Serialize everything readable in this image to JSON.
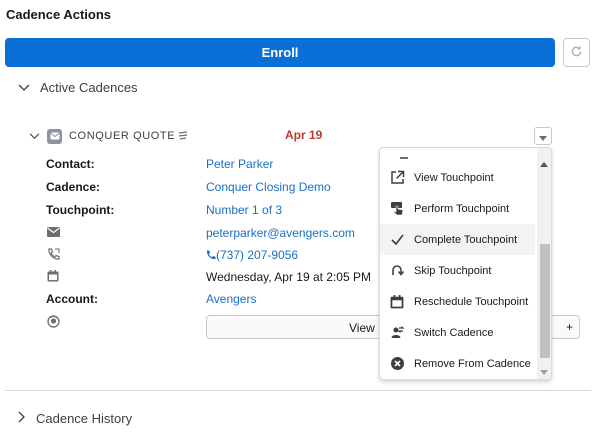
{
  "header": {
    "title": "Cadence Actions"
  },
  "toolbar": {
    "enroll_label": "Enroll",
    "refresh_icon": "refresh-icon"
  },
  "sections": {
    "active": {
      "label": "Active Cadences"
    },
    "history": {
      "label": "Cadence History"
    }
  },
  "cadence": {
    "name": "CONQUER QUOTE",
    "date": "Apr 19",
    "date_color": "#c23934",
    "details": {
      "contact_label": "Contact:",
      "contact_value": "Peter Parker",
      "cadence_label": "Cadence:",
      "cadence_value": "Conquer Closing Demo",
      "touchpoint_label": "Touchpoint:",
      "touchpoint_value": "Number 1 of 3",
      "email": "peterparker@avengers.com",
      "phone": "(737) 207-9056",
      "datetime": "Wednesday, Apr 19 at 2:05 PM",
      "account_label": "Account:",
      "account_value": "Avengers"
    },
    "view_button_label": "View L",
    "plus_label": "+"
  },
  "menu": {
    "items": [
      {
        "label": "View Touchpoint",
        "icon": "external-link-icon"
      },
      {
        "label": "Perform Touchpoint",
        "icon": "touch-icon"
      },
      {
        "label": "Complete Touchpoint",
        "icon": "check-icon",
        "highlighted": true
      },
      {
        "label": "Skip Touchpoint",
        "icon": "skip-icon"
      },
      {
        "label": "Reschedule Touchpoint",
        "icon": "calendar-icon"
      },
      {
        "label": "Switch Cadence",
        "icon": "switch-icon"
      },
      {
        "label": "Remove From Cadence",
        "icon": "remove-icon"
      }
    ]
  },
  "colors": {
    "accent": "#0b6fd8",
    "link": "#1b6fc7",
    "highlight": "#f3f3f3"
  }
}
